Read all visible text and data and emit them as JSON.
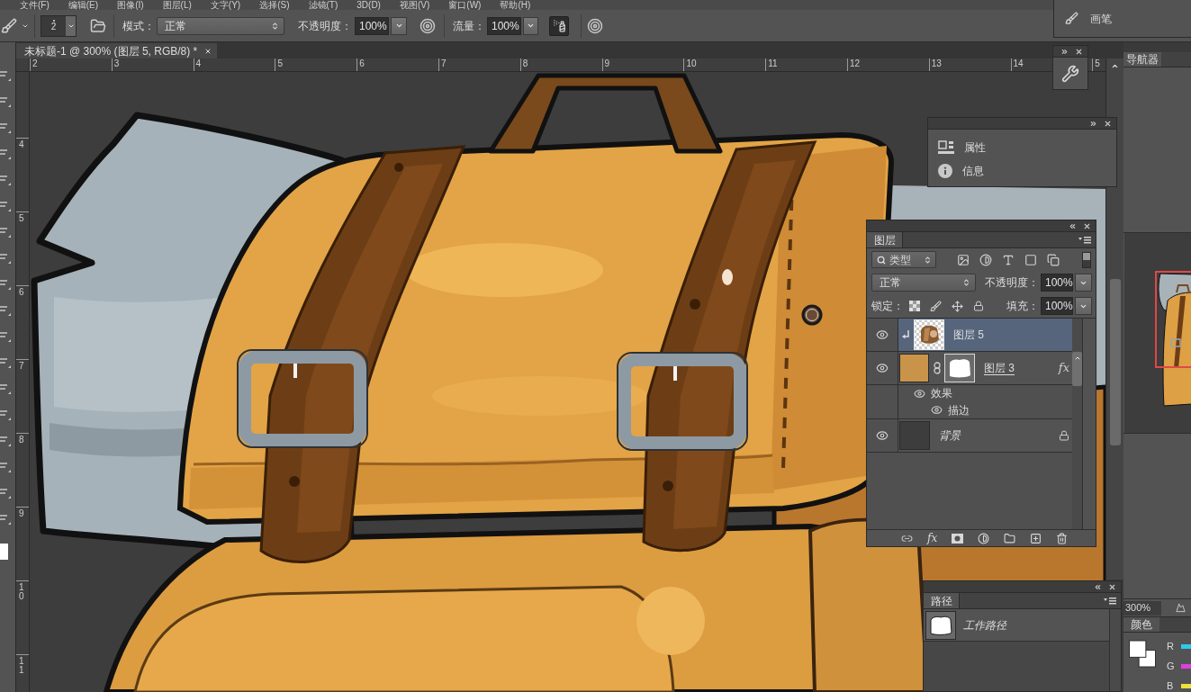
{
  "menu_bar": {
    "items": [
      "文件(F)",
      "编辑(E)",
      "图像(I)",
      "图层(L)",
      "文字(Y)",
      "选择(S)",
      "滤镜(T)",
      "3D(D)",
      "视图(V)",
      "窗口(W)",
      "帮助(H)"
    ]
  },
  "options_bar": {
    "brush_size": "2",
    "mode_label": "模式：",
    "mode": "正常",
    "opacity_label": "不透明度：",
    "opacity": "100%",
    "flow_label": "流量：",
    "flow": "100%",
    "airbrush_on": true
  },
  "brush_panel": {
    "label": "画笔"
  },
  "document_tab": {
    "title": "未标题-1 @ 300% (图层 5, RGB/8) *"
  },
  "rulers": {
    "horizontal": [
      "2",
      "3",
      "4",
      "5",
      "6",
      "7",
      "8",
      "9",
      "10",
      "11",
      "12",
      "13",
      "14",
      "5"
    ],
    "vertical": [
      "4",
      "5",
      "6",
      "7",
      "8",
      "9",
      "10",
      "11"
    ]
  },
  "properties_panel": {
    "items": [
      "属性",
      "信息"
    ]
  },
  "layers_panel": {
    "tab": "图层",
    "filter": "类型",
    "blend_mode": "正常",
    "opacity_label": "不透明度：",
    "opacity": "100%",
    "lock_label": "锁定：",
    "fill_label": "填充：",
    "fill": "100%",
    "fx_button": "fx",
    "layers": [
      {
        "name": "图层 5",
        "kind": "image",
        "selected": true,
        "visible": true,
        "clipped": true,
        "locked": false
      },
      {
        "name": "图层 3",
        "kind": "masked",
        "selected": false,
        "visible": true,
        "clipped": false,
        "locked": false,
        "fx": "fx",
        "expanded": true,
        "effects_label": "效果",
        "effects_visible": true,
        "effects": [
          {
            "name": "描边",
            "visible": true
          }
        ]
      },
      {
        "name": "背景",
        "kind": "background",
        "selected": false,
        "visible": true,
        "clipped": false,
        "locked": true
      }
    ]
  },
  "paths_panel": {
    "tab": "路径",
    "paths": [
      "工作路径"
    ]
  },
  "navigator": {
    "tab": "导航器",
    "zoom": "300%"
  },
  "color_panel": {
    "tab": "颜色",
    "channels": [
      {
        "name": "R",
        "color": "#2ccbe6"
      },
      {
        "name": "G",
        "color": "#e03ee0"
      },
      {
        "name": "B",
        "color": "#ece23a"
      }
    ]
  }
}
